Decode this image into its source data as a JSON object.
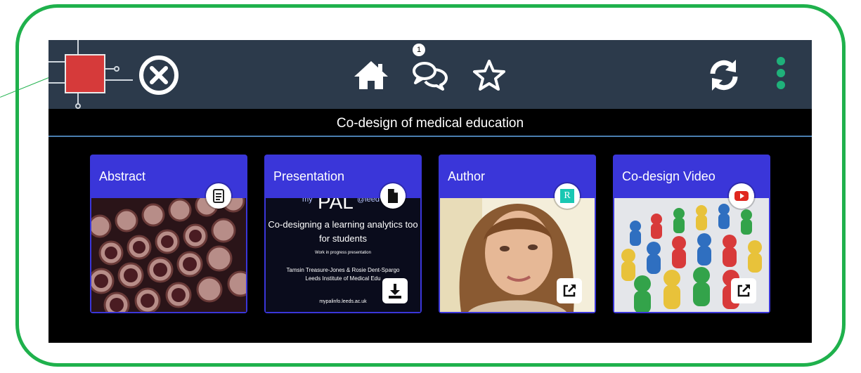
{
  "topbar": {
    "notification_count": "1",
    "icons": [
      "app-logo-icon",
      "close-icon",
      "home-icon",
      "chat-icon",
      "star-icon",
      "sync-icon",
      "more-vertical-icon"
    ]
  },
  "subtitle": "Co-design of medical education",
  "cards": [
    {
      "title": "Abstract",
      "badge_icon": "document-icon"
    },
    {
      "title": "Presentation",
      "badge_icon": "file-icon",
      "action_icon": "download-icon",
      "slide": {
        "brand_left": "my",
        "brand": "PAL",
        "brand_right": "@leed",
        "heading_line1": "Co-designing a learning analytics too",
        "heading_line2": "for students",
        "note": "Work in progress presentation",
        "authors": "Tamsin Treasure-Jones & Rosie Dent-Spargo",
        "institute": "Leeds Institute of Medical Edu",
        "url": "mypalinfo.leeds.ac.uk"
      }
    },
    {
      "title": "Author",
      "badge_icon": "researchgate-icon",
      "badge_text": "R",
      "action_icon": "external-link-icon"
    },
    {
      "title": "Co-design Video",
      "badge_icon": "youtube-icon",
      "action_icon": "external-link-icon"
    }
  ],
  "colors": {
    "frame": "#1fb14c",
    "topbar": "#2c3a4b",
    "card": "#3a36d9",
    "logo_red": "#d63a3a",
    "menu_dots": "#1fb17a"
  }
}
